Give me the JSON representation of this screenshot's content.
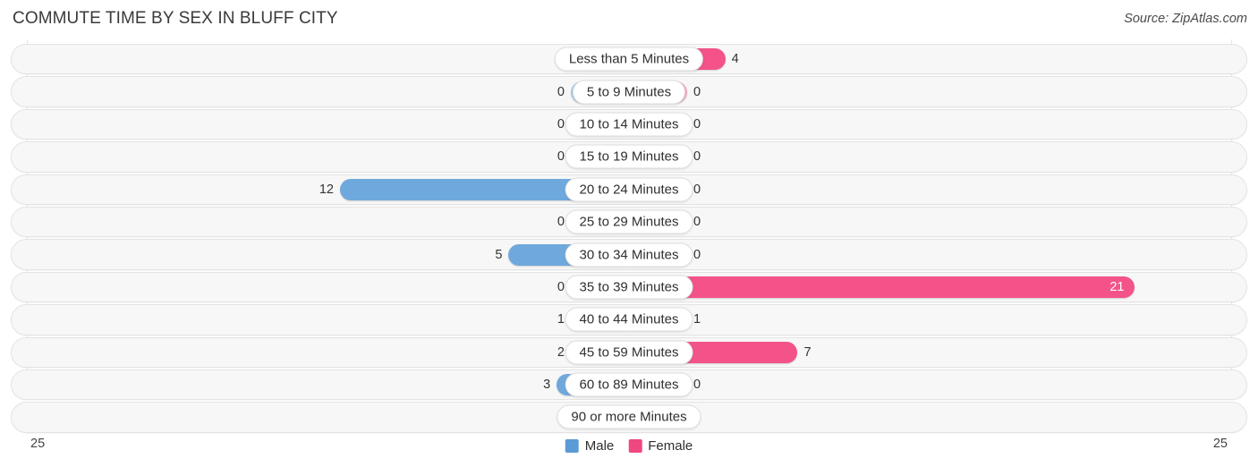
{
  "header": {
    "title": "COMMUTE TIME BY SEX IN BLUFF CITY",
    "source": "Source: ZipAtlas.com"
  },
  "axis": {
    "left_label": "25",
    "right_label": "25"
  },
  "legend": {
    "male": {
      "label": "Male",
      "color": "#5b9bd5"
    },
    "female": {
      "label": "Female",
      "color": "#ef477f"
    }
  },
  "colors": {
    "male_strong": "#6fa8dc",
    "male_zero": "#a9caeb",
    "female_strong": "#f4538a",
    "female_zero": "#f7a8c4",
    "track_bg": "#f7f7f7",
    "track_border": "#e3e3e3",
    "gridline": "#e6e6e6"
  },
  "chart_data": {
    "type": "bar",
    "subtype": "diverging-butterfly",
    "title": "COMMUTE TIME BY SEX IN BLUFF CITY",
    "xlabel": "",
    "ylabel": "",
    "xlim": [
      25,
      25
    ],
    "axis_max": 25,
    "grid": true,
    "legend_position": "bottom-center",
    "categories": [
      "Less than 5 Minutes",
      "5 to 9 Minutes",
      "10 to 14 Minutes",
      "15 to 19 Minutes",
      "20 to 24 Minutes",
      "25 to 29 Minutes",
      "30 to 34 Minutes",
      "35 to 39 Minutes",
      "40 to 44 Minutes",
      "45 to 59 Minutes",
      "60 to 89 Minutes",
      "90 or more Minutes"
    ],
    "series": [
      {
        "name": "Male",
        "side": "left",
        "values": [
          0,
          0,
          0,
          0,
          12,
          0,
          5,
          0,
          1,
          2,
          3,
          0
        ]
      },
      {
        "name": "Female",
        "side": "right",
        "values": [
          4,
          0,
          0,
          0,
          0,
          0,
          0,
          21,
          1,
          7,
          0,
          0
        ]
      }
    ]
  },
  "rows": [
    {
      "category": "Less than 5 Minutes",
      "male": "0",
      "female": "4",
      "male_value": 0,
      "female_value": 4
    },
    {
      "category": "5 to 9 Minutes",
      "male": "0",
      "female": "0",
      "male_value": 0,
      "female_value": 0
    },
    {
      "category": "10 to 14 Minutes",
      "male": "0",
      "female": "0",
      "male_value": 0,
      "female_value": 0
    },
    {
      "category": "15 to 19 Minutes",
      "male": "0",
      "female": "0",
      "male_value": 0,
      "female_value": 0
    },
    {
      "category": "20 to 24 Minutes",
      "male": "12",
      "female": "0",
      "male_value": 12,
      "female_value": 0
    },
    {
      "category": "25 to 29 Minutes",
      "male": "0",
      "female": "0",
      "male_value": 0,
      "female_value": 0
    },
    {
      "category": "30 to 34 Minutes",
      "male": "5",
      "female": "0",
      "male_value": 5,
      "female_value": 0
    },
    {
      "category": "35 to 39 Minutes",
      "male": "0",
      "female": "21",
      "male_value": 0,
      "female_value": 21
    },
    {
      "category": "40 to 44 Minutes",
      "male": "1",
      "female": "1",
      "male_value": 1,
      "female_value": 1
    },
    {
      "category": "45 to 59 Minutes",
      "male": "2",
      "female": "7",
      "male_value": 2,
      "female_value": 7
    },
    {
      "category": "60 to 89 Minutes",
      "male": "3",
      "female": "0",
      "male_value": 3,
      "female_value": 0
    },
    {
      "category": "90 or more Minutes",
      "male": "0",
      "female": "0",
      "male_value": 0,
      "female_value": 0
    }
  ]
}
